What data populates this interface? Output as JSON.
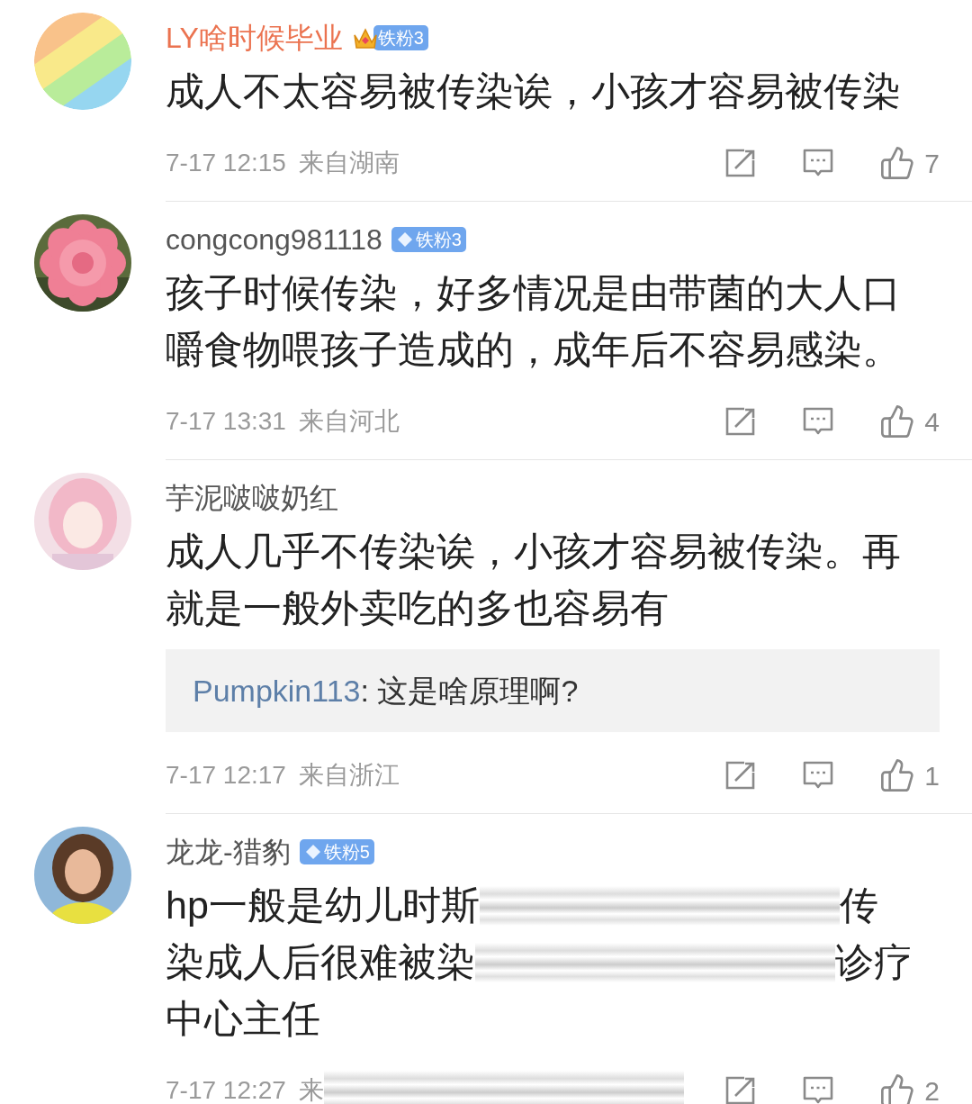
{
  "comments": [
    {
      "name": "LY啥时候毕业",
      "vip": true,
      "badge": {
        "kind": "crown",
        "label": "铁粉3"
      },
      "lines": [
        [
          {
            "kind": "text",
            "text": "成人不太容易被传染诶，小孩才容易被传染"
          }
        ]
      ],
      "time": "7-17 12:15",
      "location": "来自湖南",
      "location_smeared": false,
      "likes": "7"
    },
    {
      "name": "congcong981118",
      "vip": false,
      "badge": {
        "kind": "diamond",
        "label": "铁粉3"
      },
      "lines": [
        [
          {
            "kind": "text",
            "text": "孩子时候传染，好多情况是由带菌的大人口"
          }
        ],
        [
          {
            "kind": "text",
            "text": "嚼食物喂孩子造成的，成年后不容易感染。"
          }
        ]
      ],
      "time": "7-17 13:31",
      "location": "来自河北",
      "location_smeared": false,
      "likes": "4"
    },
    {
      "name": "芋泥啵啵奶红",
      "vip": false,
      "lines": [
        [
          {
            "kind": "text",
            "text": "成人几乎不传染诶，小孩才容易被传染。再"
          }
        ],
        [
          {
            "kind": "text",
            "text": "就是一般外卖吃的多也容易有"
          }
        ]
      ],
      "reply": {
        "user": "Pumpkin113",
        "text": ": 这是啥原理啊?"
      },
      "time": "7-17 12:17",
      "location": "来自浙江",
      "location_smeared": false,
      "likes": "1"
    },
    {
      "name": "龙龙-猎豹",
      "vip": false,
      "badge": {
        "kind": "diamond",
        "label": "铁粉5"
      },
      "lines": [
        [
          {
            "kind": "text",
            "text": "hp一般是幼儿时斯"
          },
          {
            "kind": "smear"
          },
          {
            "kind": "text",
            "text": "传"
          }
        ],
        [
          {
            "kind": "text",
            "text": "染成人后很难被染"
          },
          {
            "kind": "smear"
          },
          {
            "kind": "text",
            "text": "诊疗"
          }
        ],
        [
          {
            "kind": "text",
            "text": "中心主任"
          }
        ]
      ],
      "time": "7-17 12:27",
      "location": "来",
      "location_smeared": true,
      "likes": "2"
    }
  ]
}
